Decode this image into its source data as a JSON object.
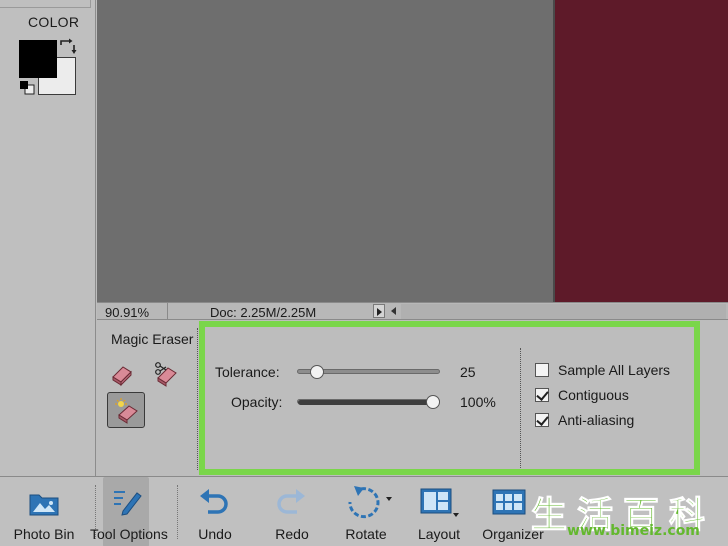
{
  "color_panel": {
    "label": "COLOR",
    "foreground": "#000000",
    "background": "#ececec"
  },
  "canvas": {
    "bg_color": "#6e6e6e",
    "image_color": "#5e1a29"
  },
  "status_bar": {
    "zoom": "90.91%",
    "doc_info": "Doc: 2.25M/2.25M"
  },
  "tool_options": {
    "tool_name": "Magic Eraser",
    "tolerance": {
      "label": "Tolerance:",
      "value_text": "25",
      "value": 25,
      "max": 255
    },
    "opacity": {
      "label": "Opacity:",
      "value_text": "100%",
      "value": 100,
      "max": 100
    },
    "checkboxes": [
      {
        "label": "Sample All Layers",
        "checked": false
      },
      {
        "label": "Contiguous",
        "checked": true
      },
      {
        "label": "Anti-aliasing",
        "checked": true
      }
    ],
    "highlight_color": "#7ad64a"
  },
  "taskbar": {
    "items": [
      {
        "label": "Photo Bin",
        "icon": "photo-bin-icon"
      },
      {
        "label": "Tool Options",
        "icon": "tool-options-icon",
        "active": true
      },
      {
        "label": "Undo",
        "icon": "undo-icon"
      },
      {
        "label": "Redo",
        "icon": "redo-icon"
      },
      {
        "label": "Rotate",
        "icon": "rotate-icon"
      },
      {
        "label": "Layout",
        "icon": "layout-icon"
      },
      {
        "label": "Organizer",
        "icon": "organizer-icon"
      }
    ]
  },
  "watermark": {
    "chars": "生活百科",
    "url": "www.bimeiz.com"
  }
}
